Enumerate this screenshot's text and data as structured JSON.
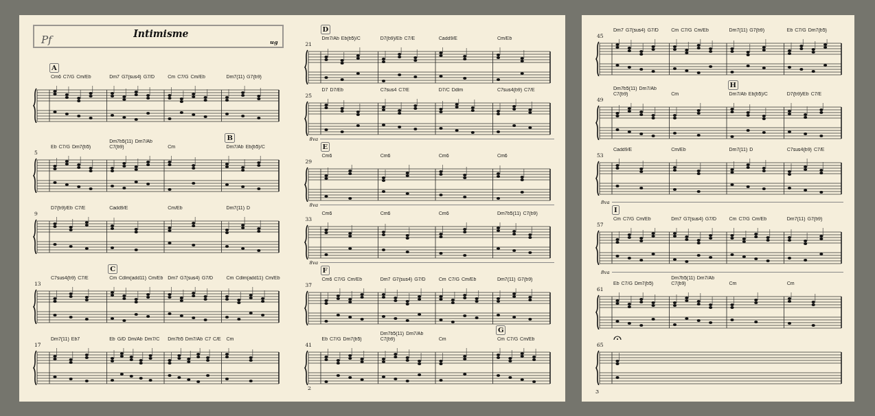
{
  "sheets": [
    {
      "header": {
        "instrument": "Pf",
        "title": "Intimisme",
        "composer": "ug"
      },
      "page_number": "2",
      "columns": [
        [
          {
            "measures": [
              {
                "rehearsal": "A",
                "chords": [
                  "Cm6",
                  "C7/G",
                  "Cm/Eb"
                ]
              },
              {
                "chords": [
                  "Dm7",
                  "G7(sus4)",
                  "G7/D"
                ]
              },
              {
                "chords": [
                  "Cm",
                  "C7/G",
                  "Cm/Eb"
                ]
              },
              {
                "chords": [
                  "Dm7(11)",
                  "G7(b9)"
                ]
              }
            ]
          },
          {
            "number": "5",
            "measures": [
              {
                "chords": [
                  "Eb",
                  "C7/G",
                  "Dm7(b5)"
                ]
              },
              {
                "chords": [
                  "Dm7b5(11)",
                  "Dm7/Ab",
                  "C7(b9)"
                ]
              },
              {
                "chords": [
                  "Cm"
                ]
              },
              {
                "rehearsal": "B",
                "chords": [
                  "Dm7/Ab",
                  "Eb(b5)/C"
                ]
              }
            ]
          },
          {
            "number": "9",
            "measures": [
              {
                "chords": [
                  "D7(b9)/Eb",
                  "C7/E"
                ]
              },
              {
                "chords": [
                  "Cadd9/E"
                ]
              },
              {
                "chords": [
                  "Cm/Eb"
                ]
              },
              {
                "chords": [
                  "Dm7(11)",
                  "D"
                ]
              }
            ]
          },
          {
            "number": "13",
            "measures": [
              {
                "chords": [
                  "C7sus4(b9)",
                  "C7/E"
                ]
              },
              {
                "rehearsal": "C",
                "chords": [
                  "Cm",
                  "Cdim(add11)",
                  "Cm/Eb"
                ]
              },
              {
                "chords": [
                  "Dm7",
                  "G7(sus4)",
                  "G7/D"
                ]
              },
              {
                "chords": [
                  "Cm",
                  "Cdim(add11)",
                  "Cm/Eb"
                ]
              }
            ]
          },
          {
            "number": "17",
            "measures": [
              {
                "chords": [
                  "Dm7(11)",
                  "Eb7"
                ]
              },
              {
                "chords": [
                  "Eb",
                  "G/D",
                  "Dm/Ab",
                  "Dm7/C"
                ]
              },
              {
                "chords": [
                  "Dm7b5",
                  "Dm7/Ab",
                  "C7",
                  "C/E"
                ]
              },
              {
                "chords": [
                  "Cm"
                ]
              }
            ]
          }
        ],
        [
          {
            "number": "21",
            "measures": [
              {
                "rehearsal": "D",
                "chords": [
                  "Dm7/Ab",
                  "Eb(b5)/C"
                ]
              },
              {
                "chords": [
                  "D7(b9)/Eb",
                  "C7/E"
                ]
              },
              {
                "chords": [
                  "Cadd9/E"
                ]
              },
              {
                "chords": [
                  "Cm/Eb"
                ]
              }
            ]
          },
          {
            "number": "25",
            "measures": [
              {
                "chords": [
                  "D7",
                  "D7/Eb"
                ]
              },
              {
                "chords": [
                  "C7sus4",
                  "C7/E"
                ]
              },
              {
                "chords": [
                  "D7/C",
                  "Ddim"
                ]
              },
              {
                "chords": [
                  "C7sus4(b9)",
                  "C7/E"
                ]
              }
            ]
          },
          {
            "number": "29",
            "ottava": "8va",
            "measures": [
              {
                "rehearsal": "E",
                "chords": [
                  "Cm6"
                ]
              },
              {
                "chords": [
                  "Cm6"
                ]
              },
              {
                "chords": [
                  "Cm6"
                ]
              },
              {
                "chords": [
                  "Cm6"
                ]
              }
            ]
          },
          {
            "number": "33",
            "ottava": "8va",
            "measures": [
              {
                "chords": [
                  "Cm6"
                ]
              },
              {
                "chords": [
                  "Cm6"
                ]
              },
              {
                "chords": [
                  "Cm6"
                ]
              },
              {
                "chords": [
                  "Dm7b5(11)",
                  "C7(b9)"
                ]
              }
            ]
          },
          {
            "number": "37",
            "ottava": "8va",
            "measures": [
              {
                "rehearsal": "F",
                "chords": [
                  "Cm6",
                  "C7/G",
                  "Cm/Eb"
                ]
              },
              {
                "chords": [
                  "Dm7",
                  "G7(sus4)",
                  "G7/D"
                ]
              },
              {
                "chords": [
                  "Cm",
                  "C7/G",
                  "Cm/Eb"
                ]
              },
              {
                "chords": [
                  "Dm7(11)",
                  "G7(b9)"
                ]
              }
            ]
          },
          {
            "number": "41",
            "measures": [
              {
                "chords": [
                  "Eb",
                  "C7/G",
                  "Dm7(b5)"
                ]
              },
              {
                "chords": [
                  "Dm7b5(11)",
                  "Dm7/Ab",
                  "C7(b9)"
                ]
              },
              {
                "chords": [
                  "Cm"
                ]
              },
              {
                "rehearsal": "G",
                "chords": [
                  "Cm",
                  "C7/G",
                  "Cm/Eb"
                ]
              }
            ]
          }
        ]
      ]
    },
    {
      "page_number": "3",
      "columns": [
        [
          {
            "number": "45",
            "measures": [
              {
                "chords": [
                  "Dm7",
                  "G7(sus4)",
                  "G7/D"
                ]
              },
              {
                "chords": [
                  "Cm",
                  "C7/G",
                  "Cm/Eb"
                ]
              },
              {
                "chords": [
                  "Dm7(11)",
                  "G7(b9)"
                ]
              },
              {
                "chords": [
                  "Eb",
                  "C7/G",
                  "Dm7(b5)"
                ]
              }
            ]
          },
          {
            "number": "49",
            "measures": [
              {
                "chords": [
                  "Dm7b5(11)",
                  "Dm7/Ab",
                  "C7(b9)"
                ]
              },
              {
                "chords": [
                  "Cm"
                ]
              },
              {
                "rehearsal": "H",
                "chords": [
                  "Dm7/Ab",
                  "Eb(b5)/C"
                ]
              },
              {
                "chords": [
                  "D7(b9)/Eb",
                  "C7/E"
                ]
              }
            ]
          },
          {
            "number": "53",
            "measures": [
              {
                "chords": [
                  "Cadd9/E"
                ]
              },
              {
                "chords": [
                  "Cm/Eb"
                ]
              },
              {
                "chords": [
                  "Dm7(11)",
                  "D"
                ]
              },
              {
                "chords": [
                  "C7sus4(b9)",
                  "C7/E"
                ]
              }
            ]
          },
          {
            "number": "57",
            "ottava": "8va",
            "measures": [
              {
                "rehearsal": "I",
                "chords": [
                  "Cm",
                  "C7/G",
                  "Cm/Eb"
                ]
              },
              {
                "chords": [
                  "Dm7",
                  "G7(sus4)",
                  "G7/D"
                ]
              },
              {
                "chords": [
                  "Cm",
                  "C7/G",
                  "Cm/Eb"
                ]
              },
              {
                "chords": [
                  "Dm7(11)",
                  "G7(b9)"
                ]
              }
            ]
          },
          {
            "number": "61",
            "ottava": "8va",
            "measures": [
              {
                "chords": [
                  "Eb",
                  "C7/G",
                  "Dm7(b5)"
                ]
              },
              {
                "chords": [
                  "Dm7b5(11)",
                  "Dm7/Ab",
                  "C7(b9)"
                ]
              },
              {
                "chords": [
                  "Cm"
                ]
              },
              {
                "chords": [
                  "Cm"
                ]
              }
            ]
          },
          {
            "number": "65",
            "measures": [
              {
                "fermata": true
              }
            ]
          }
        ]
      ]
    }
  ]
}
